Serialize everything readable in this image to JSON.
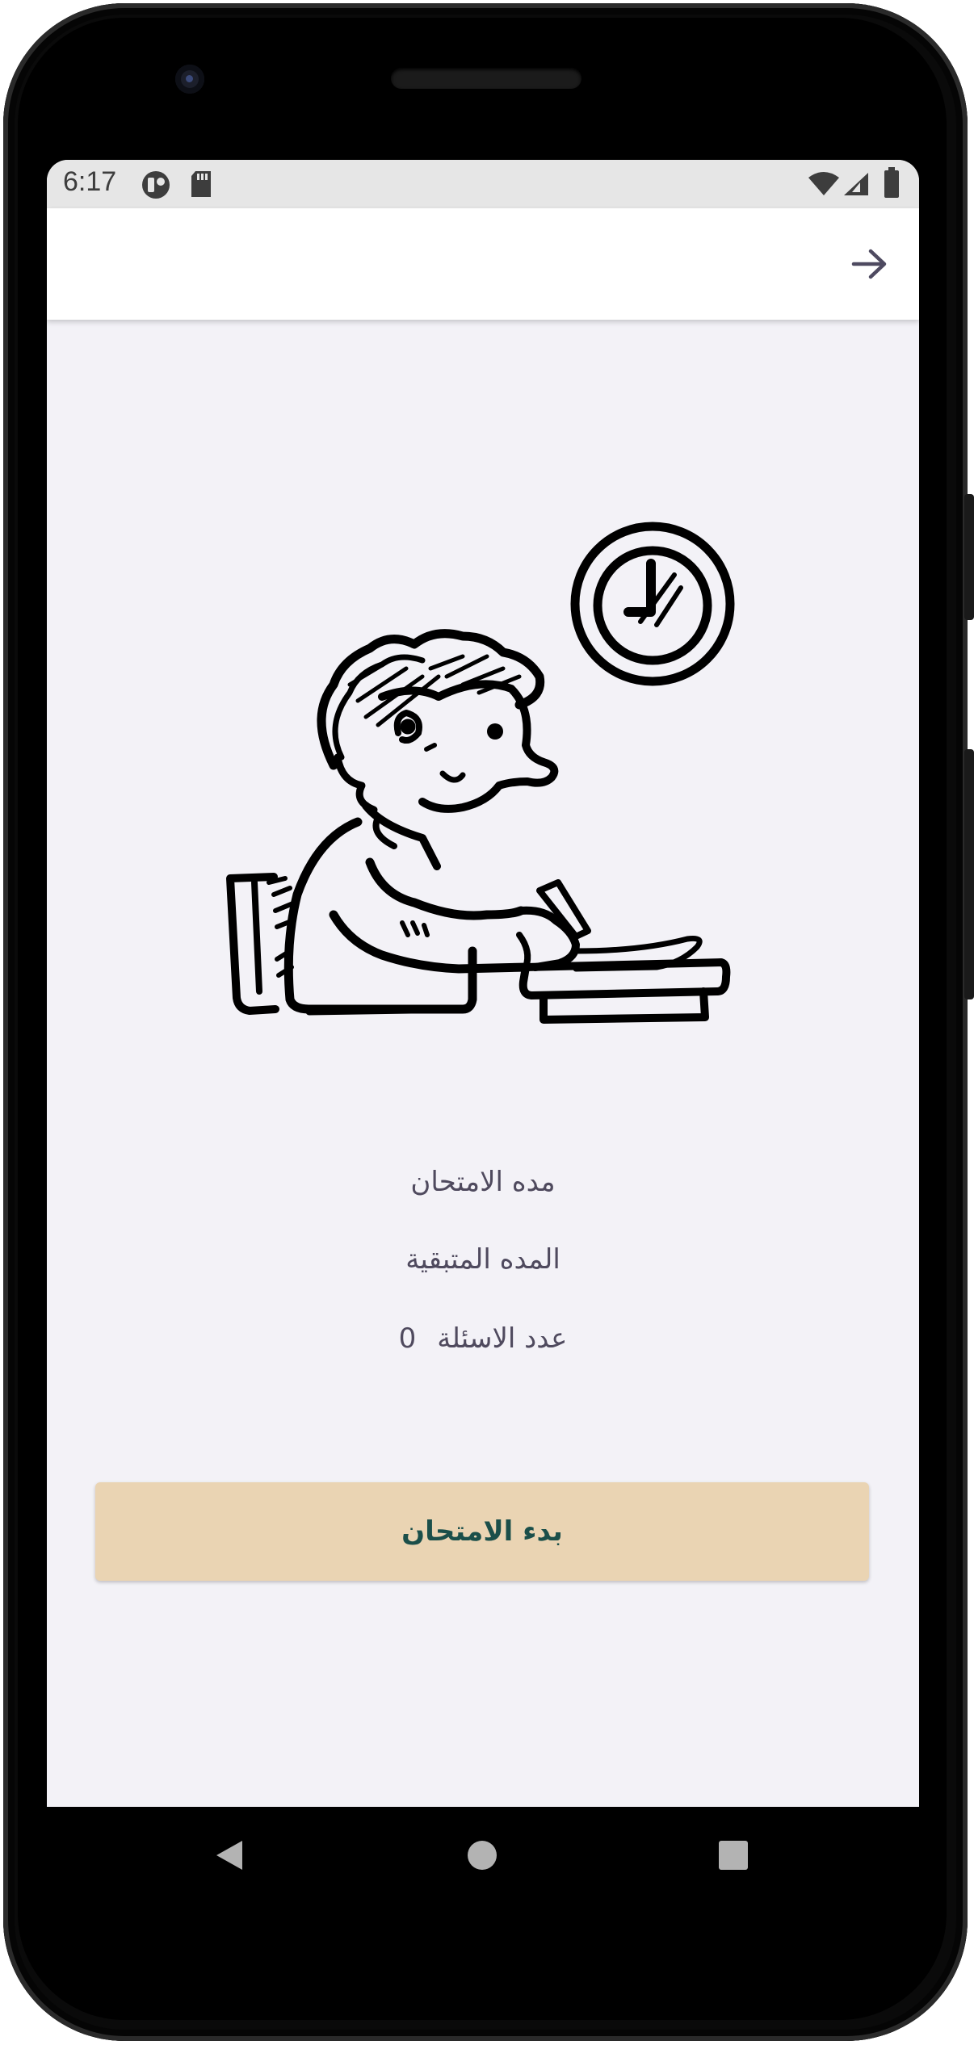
{
  "status_bar": {
    "time": "6:17",
    "icons": [
      "notification-app-icon",
      "sd-card-icon",
      "wifi-icon",
      "signal-icon",
      "battery-icon"
    ]
  },
  "app_bar": {
    "back_icon": "arrow-right-icon"
  },
  "illustration": {
    "icon": "student-writing-exam-with-clock-illustration"
  },
  "exam_info": {
    "duration_label": "مده الامتحان",
    "remaining_label": "المده المتبقية",
    "questions_label": "عدد الاسئلة",
    "questions_count": "0"
  },
  "actions": {
    "start_label": "بدء الامتحان"
  },
  "nav_bar": {
    "icons": [
      "back-triangle-icon",
      "home-circle-icon",
      "recents-square-icon"
    ]
  },
  "colors": {
    "background": "#f3f2f7",
    "start_button_bg": "#ead4b3",
    "start_button_text": "#1b4f4a",
    "info_text": "#4f4a5e",
    "status_bar_bg": "#e6e6e6"
  }
}
